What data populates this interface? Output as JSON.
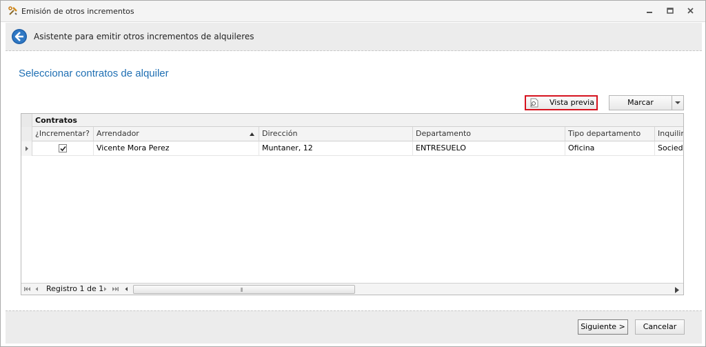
{
  "window": {
    "title": "Emisión de otros incrementos"
  },
  "header": {
    "title": "Asistente para emitir otros incrementos de alquileres"
  },
  "page": {
    "title": "Seleccionar contratos de alquiler"
  },
  "toolbar": {
    "preview_label": "Vista previa",
    "mark_label": "Marcar"
  },
  "grid": {
    "group_label": "Contratos",
    "columns": [
      "¿Incrementar?",
      "Arrendador",
      "Dirección",
      "Departamento",
      "Tipo departamento",
      "Inquilino"
    ],
    "rows": [
      {
        "incrementar": true,
        "arrendador": "Vicente Mora Perez",
        "direccion": "Muntaner, 12",
        "departamento": "ENTRESUELO",
        "tipo": "Oficina",
        "inquilino": "Sociedad"
      }
    ],
    "navigator": {
      "record_text": "Registro 1 de 1"
    }
  },
  "footer": {
    "next_label": "Siguiente >",
    "cancel_label": "Cancelar"
  },
  "icons": {
    "app": "tools-icon",
    "back": "back-arrow-icon",
    "preview": "magnifier-document-icon"
  },
  "colors": {
    "accent_title": "#1f6fb3",
    "highlight_border": "#d6121e"
  }
}
